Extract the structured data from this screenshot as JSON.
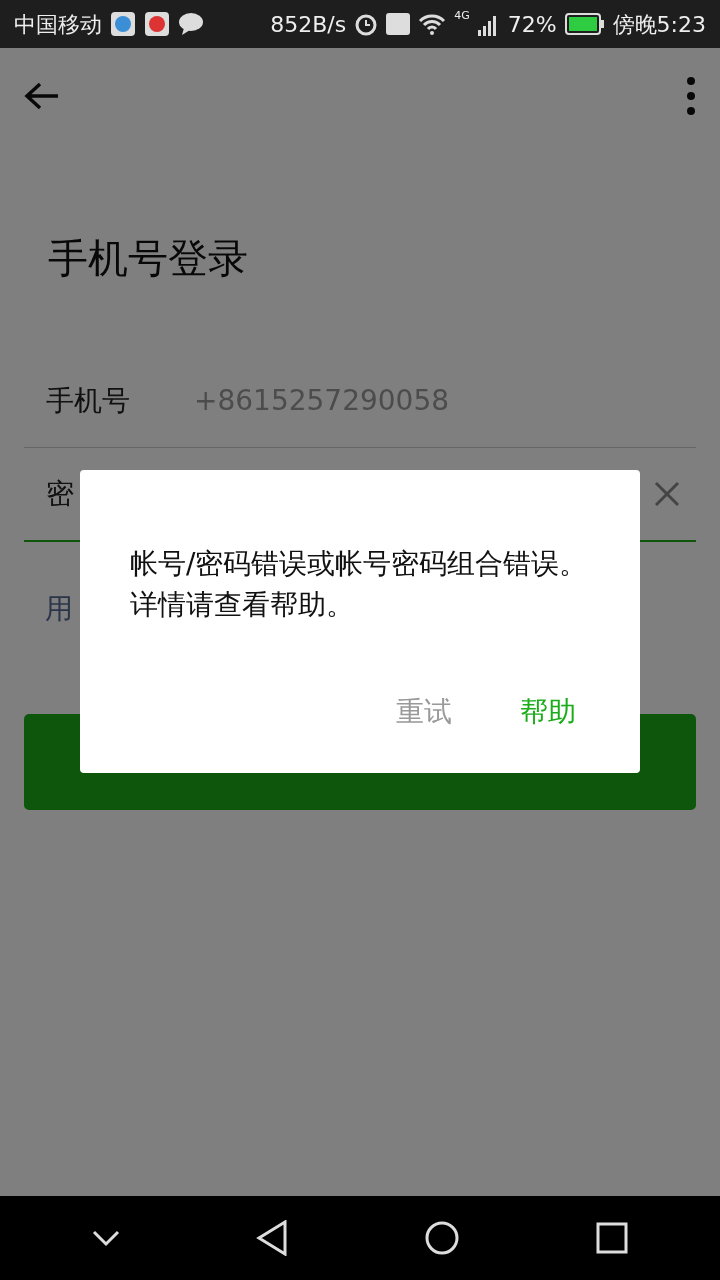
{
  "status_bar": {
    "carrier": "中国移动",
    "speed": "852B/s",
    "network": "4G",
    "battery": "72%",
    "time": "傍晚5:23"
  },
  "title": "手机号登录",
  "form": {
    "phone_label": "手机号",
    "phone_value": "+8615257290058",
    "password_label": "密",
    "password_focused": true
  },
  "link": "用",
  "dialog": {
    "message": "帐号/密码错误或帐号密码组合错误。详情请查看帮助。",
    "buttons": [
      {
        "label": "重试",
        "kind": "secondary"
      },
      {
        "label": "帮助",
        "kind": "primary"
      }
    ]
  }
}
